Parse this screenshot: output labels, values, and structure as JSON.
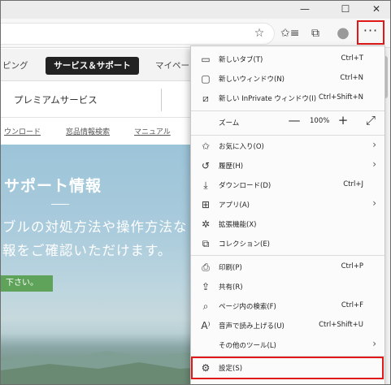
{
  "window": {
    "minimize_glyph": "—",
    "maximize_glyph": "☐",
    "close_glyph": "✕"
  },
  "toolbar": {
    "favorite_icon": "☆",
    "favorites_icon": "✩≡",
    "collections_icon": "⧉",
    "profile_icon": "●",
    "more_label": "···"
  },
  "page": {
    "nav_left": "ピング",
    "nav_service": "サービス＆サポート",
    "nav_right": "マイペー",
    "premium": "プレミアムサービス",
    "links": [
      "ウンロード",
      "窓品情報検索",
      "マニュアル"
    ],
    "hero_title": "サポート情報",
    "hero_line1": "ブルの対処方法や操作方法な",
    "hero_line2": "報をご確認いただけます。",
    "hero_button": "下さい。"
  },
  "menu": {
    "new_tab": {
      "label": "新しいタブ(T)",
      "shortcut": "Ctrl+T"
    },
    "new_window": {
      "label": "新しいウィンドウ(N)",
      "shortcut": "Ctrl+N"
    },
    "new_inprivate": {
      "label": "新しい InPrivate ウィンドウ(I)",
      "shortcut": "Ctrl+Shift+N"
    },
    "zoom": {
      "label": "ズーム",
      "minus": "—",
      "value": "100%",
      "plus": "+",
      "expand": "⤢"
    },
    "favorites": {
      "label": "お気に入り(O)"
    },
    "history": {
      "label": "履歴(H)"
    },
    "downloads": {
      "label": "ダウンロード(D)",
      "shortcut": "Ctrl+J"
    },
    "apps": {
      "label": "アプリ(A)"
    },
    "extensions": {
      "label": "拡張機能(X)"
    },
    "collections": {
      "label": "コレクション(E)"
    },
    "print": {
      "label": "印刷(P)",
      "shortcut": "Ctrl+P"
    },
    "share": {
      "label": "共有(R)"
    },
    "find": {
      "label": "ページ内の検索(F)",
      "shortcut": "Ctrl+F"
    },
    "read_aloud": {
      "label": "音声で読み上げる(U)",
      "shortcut": "Ctrl+Shift+U"
    },
    "more_tools": {
      "label": "その他のツール(L)"
    },
    "settings": {
      "label": "設定(S)"
    }
  },
  "colors": {
    "highlight": "#e01818",
    "service_tab": "#222222",
    "hero_button": "#5fa35a"
  }
}
